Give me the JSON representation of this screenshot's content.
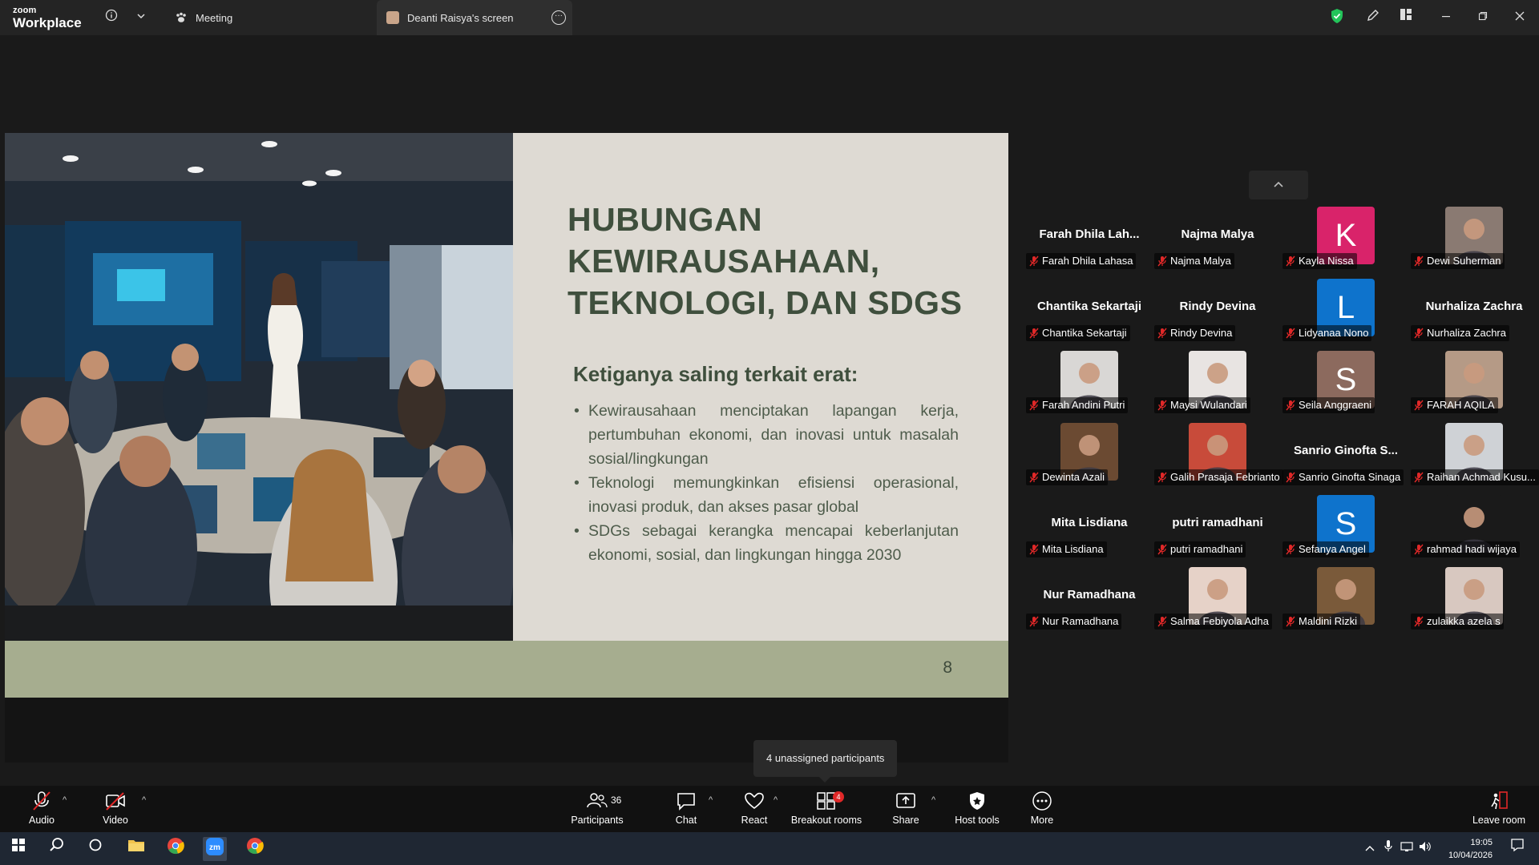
{
  "app": {
    "logo_top": "zoom",
    "logo_bottom": "Workplace"
  },
  "tabs": {
    "meeting": "Meeting",
    "screen": "Deanti Raisya's screen"
  },
  "slide": {
    "title": "HUBUNGAN KEWIRAUSAHAAN, TEKNOLOGI, DAN SDGS",
    "subtitle": "Ketiganya saling terkait erat:",
    "bullets": [
      "Kewirausahaan menciptakan lapangan kerja, pertumbuhan ekonomi, dan inovasi untuk masalah sosial/lingkungan",
      "Teknologi memungkinkan efisiensi operasional, inovasi produk, dan akses pasar global",
      "SDGs sebagai kerangka mencapai keberlanjutan ekonomi, sosial, dan lingkungan hingga 2030"
    ],
    "page_number": "8"
  },
  "gallery": {
    "participants": [
      {
        "display": "Farah Dhila Lah...",
        "label": "Farah Dhila Lahasa",
        "kind": "name"
      },
      {
        "display": "Najma Malya",
        "label": "Najma Malya",
        "kind": "name"
      },
      {
        "display": "K",
        "label": "Kayla Nissa",
        "kind": "letter",
        "color": "#d9236a"
      },
      {
        "display": "",
        "label": "Dewi Suherman",
        "kind": "photo",
        "color": "#8a7a72"
      },
      {
        "display": "Chantika Sekartaji",
        "label": "Chantika Sekartaji",
        "kind": "name"
      },
      {
        "display": "Rindy Devina",
        "label": "Rindy Devina",
        "kind": "name"
      },
      {
        "display": "L",
        "label": "Lidyanaa Nono",
        "kind": "letter",
        "color": "#0e73cc"
      },
      {
        "display": "Nurhaliza Zachra",
        "label": "Nurhaliza Zachra",
        "kind": "name"
      },
      {
        "display": "",
        "label": "Farah Andini Putri",
        "kind": "photo",
        "color": "#d9d7d5"
      },
      {
        "display": "",
        "label": "Maysi Wulandari",
        "kind": "photo",
        "color": "#e8e4e2"
      },
      {
        "display": "S",
        "label": "Seila Anggraeni",
        "kind": "letter",
        "color": "#8c6a5e"
      },
      {
        "display": "",
        "label": "FARAH AQILA",
        "kind": "photo",
        "color": "#b59a86"
      },
      {
        "display": "",
        "label": "Dewinta Azali",
        "kind": "photo",
        "color": "#6b4a32"
      },
      {
        "display": "",
        "label": "Galih Prasaja Febrianto",
        "kind": "photo",
        "color": "#c84b3a"
      },
      {
        "display": "Sanrio Ginofta S...",
        "label": "Sanrio Ginofta Sinaga",
        "kind": "name"
      },
      {
        "display": "",
        "label": "Raihan Achmad Kusu...",
        "kind": "photo",
        "color": "#cfd2d6"
      },
      {
        "display": "Mita Lisdiana",
        "label": "Mita Lisdiana",
        "kind": "name"
      },
      {
        "display": "putri ramadhani",
        "label": "putri ramadhani",
        "kind": "name"
      },
      {
        "display": "S",
        "label": "Sefanya Angel",
        "kind": "letter",
        "color": "#0e73cc"
      },
      {
        "display": "",
        "label": "rahmad hadi wijaya",
        "kind": "photo",
        "color": "#1a1a1a"
      },
      {
        "display": "Nur Ramadhana",
        "label": "Nur Ramadhana",
        "kind": "name"
      },
      {
        "display": "",
        "label": "Salma Febiyola Adha",
        "kind": "photo",
        "color": "#e6d2c8"
      },
      {
        "display": "",
        "label": "Maldini Rizki",
        "kind": "photo",
        "color": "#7a5a3a"
      },
      {
        "display": "",
        "label": "zulaikka azela s",
        "kind": "photo",
        "color": "#d8c8c0"
      }
    ]
  },
  "tooltip": "4 unassigned participants",
  "toolbar": {
    "audio": "Audio",
    "video": "Video",
    "participants": "Participants",
    "participants_count": "36",
    "chat": "Chat",
    "react": "React",
    "breakout": "Breakout rooms",
    "breakout_badge": "4",
    "share": "Share",
    "host_tools": "Host tools",
    "more": "More",
    "leave": "Leave room"
  },
  "taskbar": {
    "time": "19:05",
    "date": "10/04/2026"
  },
  "colors": {
    "security_shield": "#23c45a",
    "mute_red": "#e02828",
    "slide_bg": "#dedad3",
    "slide_footer": "#a6ad8f",
    "slide_title": "#3f4f3d"
  }
}
